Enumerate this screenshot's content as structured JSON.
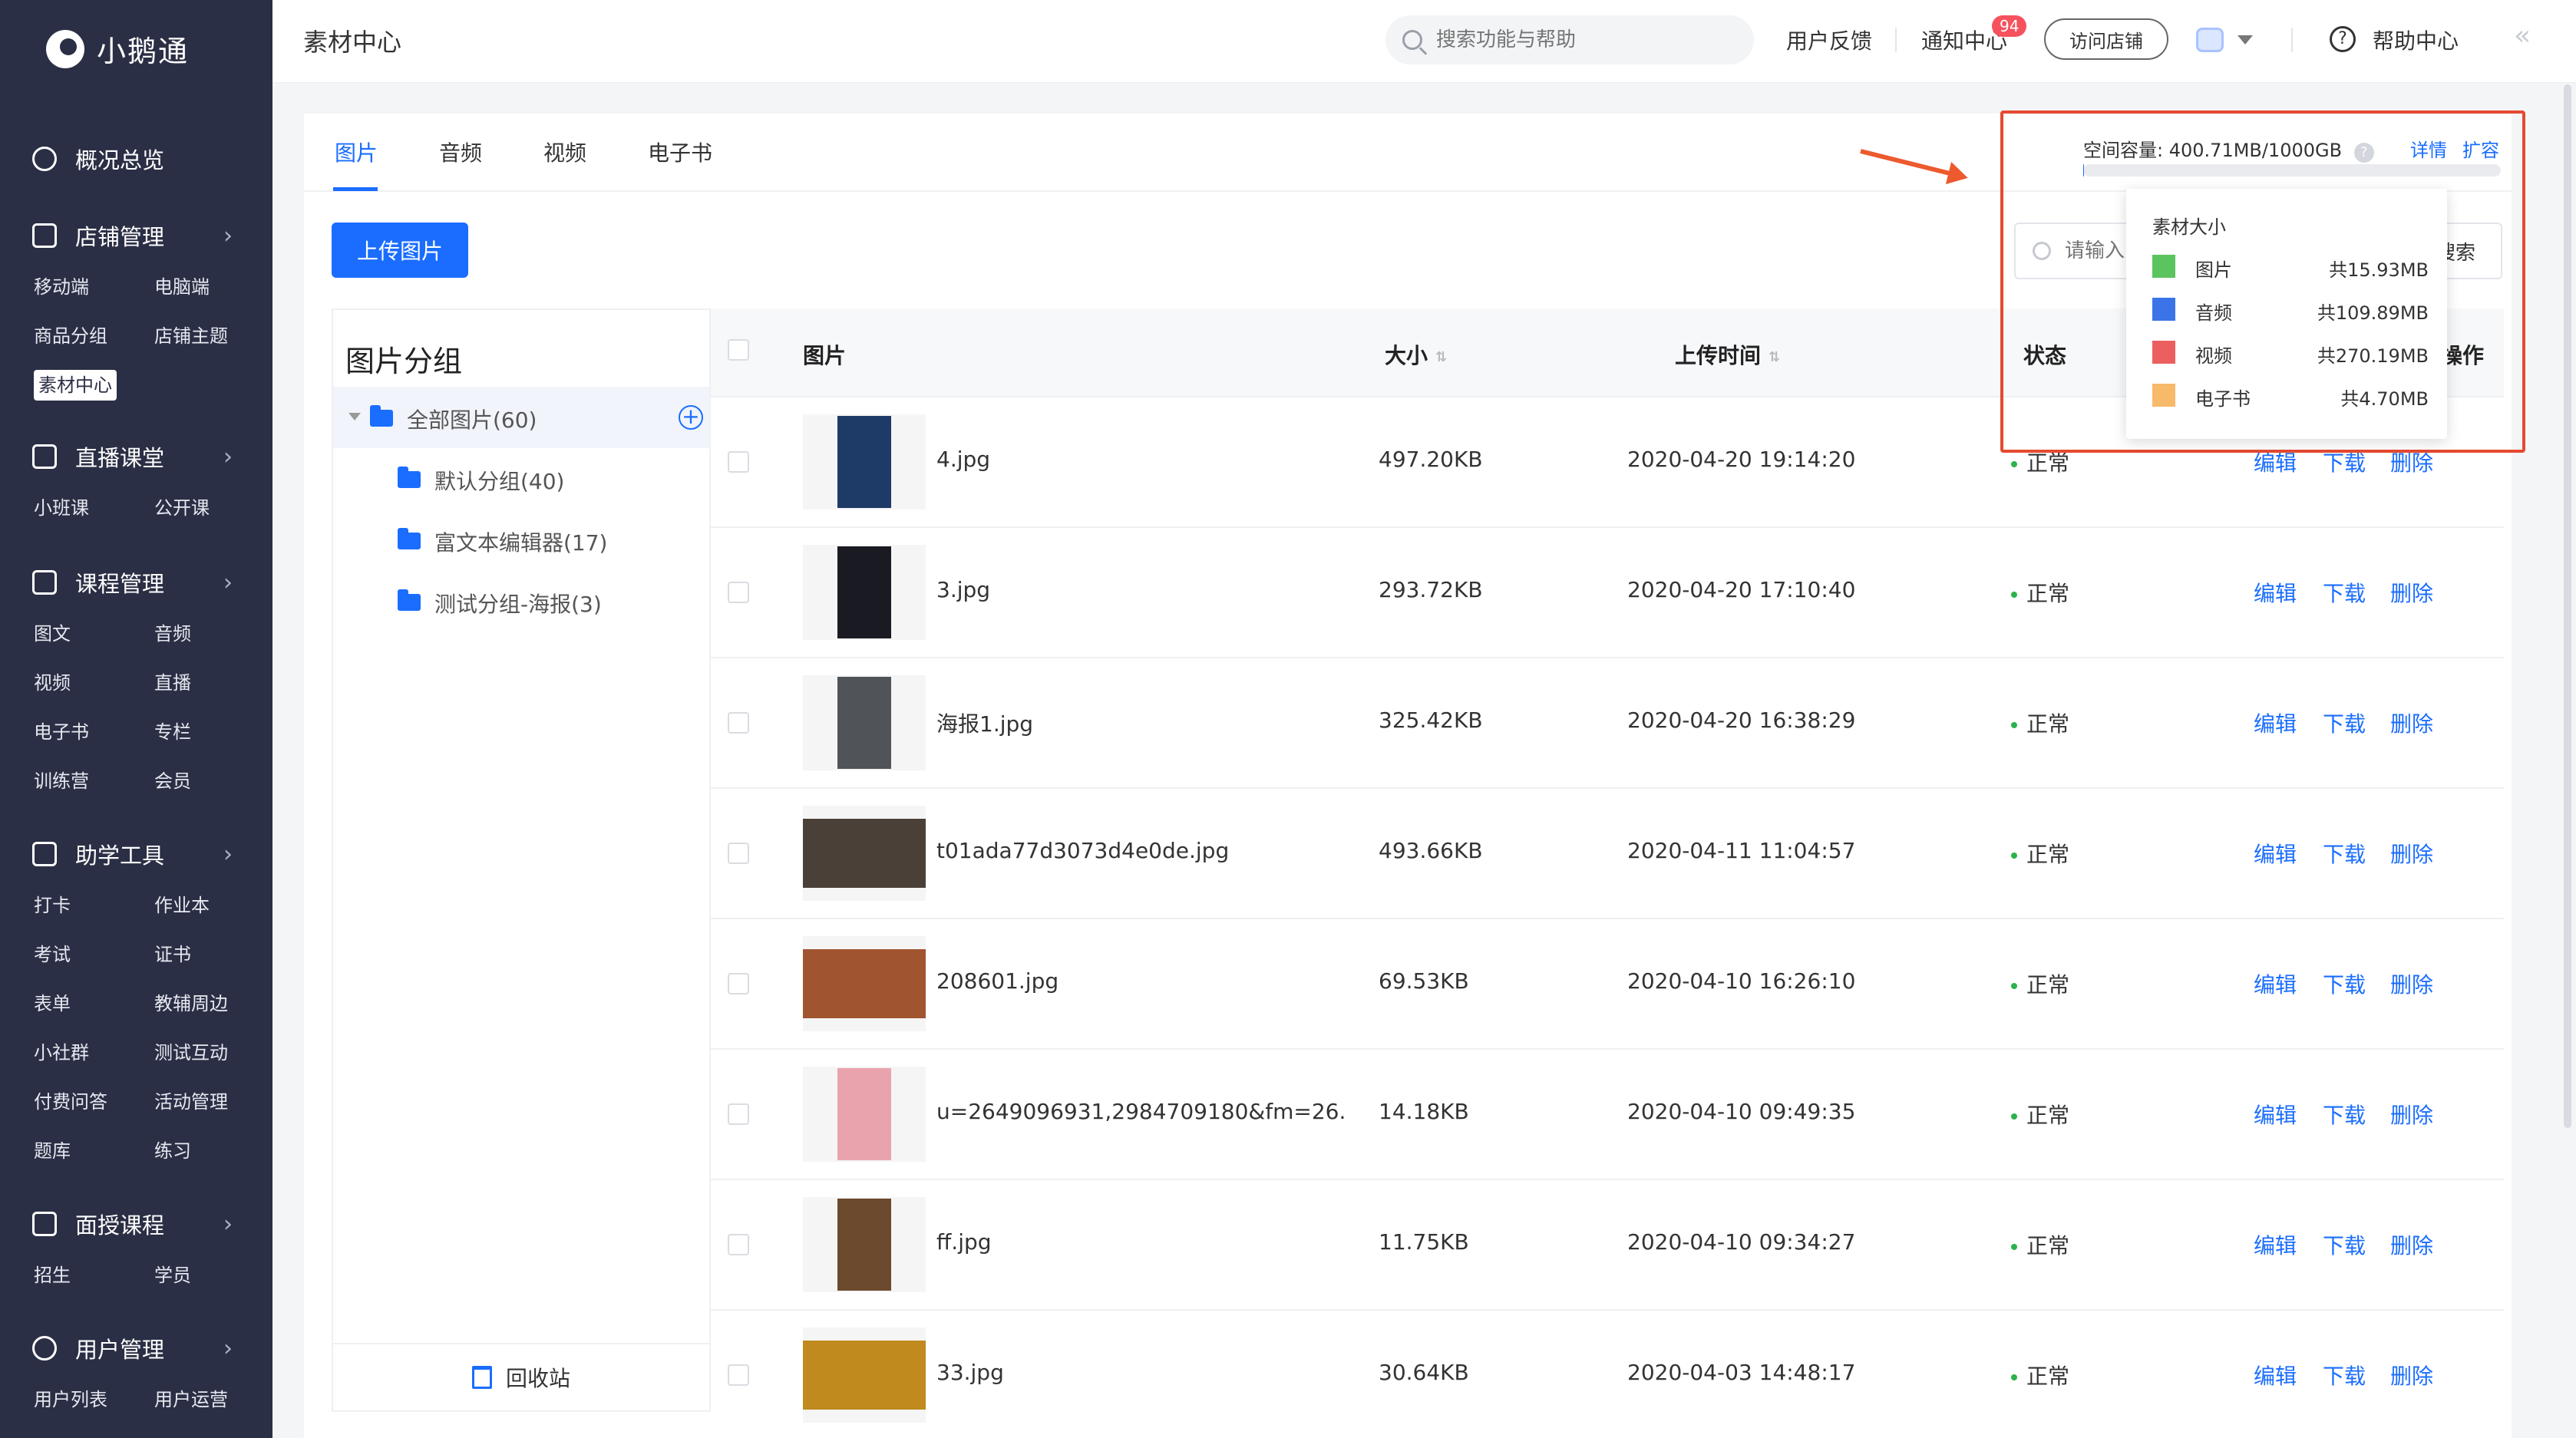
{
  "app": {
    "name": "小鹅通"
  },
  "sidebar": {
    "overview": "概况总览",
    "sections": [
      {
        "title": "店铺管理",
        "items": [
          "移动端",
          "电脑端",
          "商品分组",
          "店铺主题",
          "素材中心"
        ]
      },
      {
        "title": "直播课堂",
        "items": [
          "小班课",
          "公开课"
        ]
      },
      {
        "title": "课程管理",
        "items": [
          "图文",
          "音频",
          "视频",
          "直播",
          "电子书",
          "专栏",
          "训练营",
          "会员"
        ]
      },
      {
        "title": "助学工具",
        "items": [
          "打卡",
          "作业本",
          "考试",
          "证书",
          "表单",
          "教辅周边",
          "小社群",
          "测试互动",
          "付费问答",
          "活动管理",
          "题库",
          "练习"
        ]
      },
      {
        "title": "面授课程",
        "items": [
          "招生",
          "学员"
        ]
      },
      {
        "title": "用户管理",
        "items": [
          "用户列表",
          "用户运营"
        ]
      }
    ],
    "active_item": "素材中心"
  },
  "header": {
    "title": "素材中心",
    "search_placeholder": "搜索功能与帮助",
    "feedback": "用户反馈",
    "notifications": "通知中心",
    "notification_count": "94",
    "visit_store": "访问店铺",
    "help": "帮助中心"
  },
  "tabs": [
    "图片",
    "音频",
    "视频",
    "电子书"
  ],
  "active_tab": "图片",
  "upload_button": "上传图片",
  "search": {
    "placeholder": "请输入",
    "button": "搜索"
  },
  "groups": {
    "title": "图片分组",
    "all": "全部图片(60)",
    "items": [
      "默认分组(40)",
      "富文本编辑器(17)",
      "测试分组-海报(3)"
    ],
    "recycle": "回收站"
  },
  "table": {
    "headers": {
      "image": "图片",
      "size": "大小",
      "time": "上传时间",
      "status": "状态",
      "ops": "操作"
    },
    "ops": {
      "edit": "编辑",
      "download": "下载",
      "delete": "删除"
    },
    "rows": [
      {
        "name": "4.jpg",
        "size": "497.20KB",
        "time": "2020-04-20 19:14:20",
        "status": "正常",
        "thumb": "#1e3a66"
      },
      {
        "name": "3.jpg",
        "size": "293.72KB",
        "time": "2020-04-20 17:10:40",
        "status": "正常",
        "thumb": "#1a1a22"
      },
      {
        "name": "海报1.jpg",
        "size": "325.42KB",
        "time": "2020-04-20 16:38:29",
        "status": "正常",
        "thumb": "#505458"
      },
      {
        "name": "t01ada77d3073d4e0de.jpg",
        "size": "493.66KB",
        "time": "2020-04-11 11:04:57",
        "status": "正常",
        "thumb": "#4a4038"
      },
      {
        "name": "208601.jpg",
        "size": "69.53KB",
        "time": "2020-04-10 16:26:10",
        "status": "正常",
        "thumb": "#a0542f"
      },
      {
        "name": "u=2649096931,2984709180&fm=26.",
        "size": "14.18KB",
        "time": "2020-04-10 09:49:35",
        "status": "正常",
        "thumb": "#e9a3ac"
      },
      {
        "name": "ff.jpg",
        "size": "11.75KB",
        "time": "2020-04-10 09:34:27",
        "status": "正常",
        "thumb": "#6b4a2d"
      },
      {
        "name": "33.jpg",
        "size": "30.64KB",
        "time": "2020-04-03 14:48:17",
        "status": "正常",
        "thumb": "#c08a1e"
      }
    ]
  },
  "storage": {
    "label": "空间容量:",
    "value": "400.71MB/1000GB",
    "detail": "详情",
    "expand": "扩容",
    "popup_title": "素材大小",
    "breakdown": [
      {
        "name": "图片",
        "value": "共15.93MB",
        "color": "#5cc45f"
      },
      {
        "name": "音频",
        "value": "共109.89MB",
        "color": "#3b74e8"
      },
      {
        "name": "视频",
        "value": "共270.19MB",
        "color": "#ec5f5f"
      },
      {
        "name": "电子书",
        "value": "共4.70MB",
        "color": "#f7b96a"
      }
    ]
  }
}
